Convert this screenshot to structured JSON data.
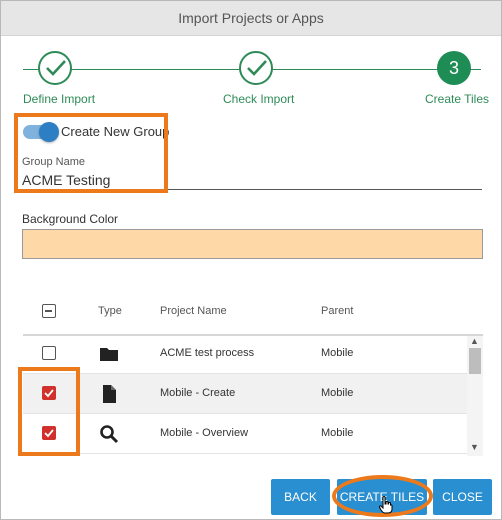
{
  "dialog": {
    "title": "Import Projects or Apps"
  },
  "stepper": {
    "steps": [
      {
        "label": "Define Import",
        "state": "done"
      },
      {
        "label": "Check Import",
        "state": "done"
      },
      {
        "label": "Create Tiles",
        "state": "active",
        "number": "3"
      }
    ]
  },
  "group": {
    "toggle_label": "Create New Group",
    "toggle_on": true,
    "name_label": "Group Name",
    "name_value": "ACME Testing"
  },
  "background": {
    "label": "Background Color",
    "color": "#ffd8a8"
  },
  "table": {
    "headers": {
      "type": "Type",
      "project": "Project Name",
      "parent": "Parent"
    },
    "rows": [
      {
        "checked": false,
        "type_icon": "folder-icon",
        "project": "ACME test process",
        "parent": "Mobile"
      },
      {
        "checked": true,
        "type_icon": "file-icon",
        "project": "Mobile - Create",
        "parent": "Mobile"
      },
      {
        "checked": true,
        "type_icon": "search-icon",
        "project": "Mobile - Overview",
        "parent": "Mobile"
      }
    ]
  },
  "buttons": {
    "back": "BACK",
    "create": "CREATE TILES",
    "close": "CLOSE"
  },
  "colors": {
    "accent": "#2e8b57",
    "button": "#2a8fd0",
    "highlight": "#ec7a1c",
    "checkbox": "#d0312d"
  }
}
